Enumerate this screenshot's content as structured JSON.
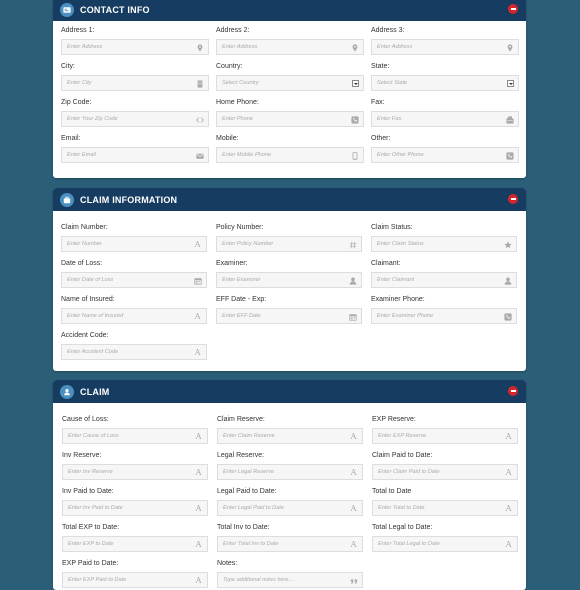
{
  "contact": {
    "title": "CONTACT INFO",
    "fields": [
      {
        "label": "Address 1:",
        "placeholder": "Enter Address",
        "icon": "map-pin-icon"
      },
      {
        "label": "Address 2:",
        "placeholder": "Enter Address",
        "icon": "map-pin-icon"
      },
      {
        "label": "Address 3:",
        "placeholder": "Enter Address",
        "icon": "map-pin-icon"
      },
      {
        "label": "City:",
        "placeholder": "Enter City",
        "icon": "building-icon"
      },
      {
        "label": "Country:",
        "placeholder": "Select Country",
        "icon": "select-arrow-icon"
      },
      {
        "label": "State:",
        "placeholder": "Select State",
        "icon": "select-arrow-icon"
      },
      {
        "label": "Zip Code:",
        "placeholder": "Enter Your Zip Code",
        "icon": "code-icon"
      },
      {
        "label": "Home Phone:",
        "placeholder": "Enter Phone",
        "icon": "phone-icon"
      },
      {
        "label": "Fax:",
        "placeholder": "Enter Fax",
        "icon": "fax-icon"
      },
      {
        "label": "Email:",
        "placeholder": "Enter Email",
        "icon": "envelope-icon"
      },
      {
        "label": "Mobile:",
        "placeholder": "Enter Mobile Phone",
        "icon": "mobile-icon"
      },
      {
        "label": "Other:",
        "placeholder": "Enter Other Phone",
        "icon": "phone-icon"
      }
    ]
  },
  "claim_info": {
    "title": "CLAIM INFORMATION",
    "fields": [
      {
        "label": "Claim Number:",
        "placeholder": "Enter Number",
        "icon": "text-icon"
      },
      {
        "label": "Policy Number:",
        "placeholder": "Enter Policy Number",
        "icon": "hash-icon"
      },
      {
        "label": "Claim Status:",
        "placeholder": "Enter Claim Status",
        "icon": "star-icon"
      },
      {
        "label": "Date of Loss:",
        "placeholder": "Enter Date of Loss",
        "icon": "calendar-icon"
      },
      {
        "label": "Examiner:",
        "placeholder": "Enter Examiner",
        "icon": "user-icon"
      },
      {
        "label": "Claimant:",
        "placeholder": "Enter Claimant",
        "icon": "user-icon"
      },
      {
        "label": "Name of Insured:",
        "placeholder": "Enter Name of Insured",
        "icon": "text-icon"
      },
      {
        "label": "EFF Date - Exp:",
        "placeholder": "Enter EFF Date",
        "icon": "calendar-icon"
      },
      {
        "label": "Examiner Phone:",
        "placeholder": "Enter Examiner Phone",
        "icon": "phone-icon"
      },
      {
        "label": "Accident Code:",
        "placeholder": "Enter Accident Code",
        "icon": "text-icon"
      }
    ]
  },
  "claim": {
    "title": "CLAIM",
    "fields": [
      {
        "label": "Cause of Loss:",
        "placeholder": "Enter Cause of Loss",
        "icon": "text-icon"
      },
      {
        "label": "Claim Reserve:",
        "placeholder": "Enter Claim Reserve",
        "icon": "text-icon"
      },
      {
        "label": "EXP Reserve:",
        "placeholder": "Enter EXP Reserve",
        "icon": "text-icon"
      },
      {
        "label": "Inv Reserve:",
        "placeholder": "Enter Inv Reserve",
        "icon": "text-icon"
      },
      {
        "label": "Legal Reserve:",
        "placeholder": "Enter Legal Reserve",
        "icon": "text-icon"
      },
      {
        "label": "Claim Paid to Date:",
        "placeholder": "Enter Claim Paid to Date",
        "icon": "text-icon"
      },
      {
        "label": "Inv Paid to Date:",
        "placeholder": "Enter Inv Paid to Date",
        "icon": "text-icon"
      },
      {
        "label": "Legal Paid to Date:",
        "placeholder": "Enter Legal Paid to Date",
        "icon": "text-icon"
      },
      {
        "label": "Total to Date",
        "placeholder": "Enter Total to Date",
        "icon": "text-icon"
      },
      {
        "label": "Total EXP to Date:",
        "placeholder": "Enter EXP to Date",
        "icon": "text-icon"
      },
      {
        "label": "Total Inv to Date:",
        "placeholder": "Enter Total Inv to Date",
        "icon": "text-icon"
      },
      {
        "label": "Total Legal to Date:",
        "placeholder": "Enter Total Legal to Date",
        "icon": "text-icon"
      },
      {
        "label": "EXP Paid to Date:",
        "placeholder": "Enter EXP Paid to Date",
        "icon": "text-icon"
      },
      {
        "label": "Notes:",
        "placeholder": "Type additional notes here...",
        "icon": "quote-icon"
      }
    ]
  }
}
